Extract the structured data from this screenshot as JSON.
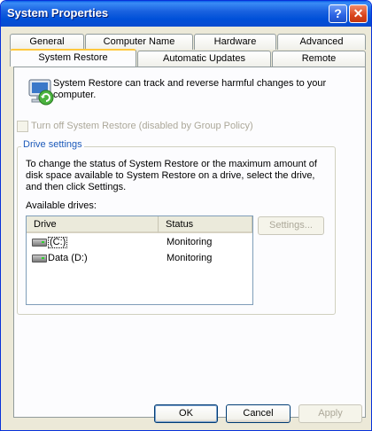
{
  "window": {
    "title": "System Properties"
  },
  "titlebar": {
    "help_glyph": "?",
    "close_glyph": "✕"
  },
  "tabs_row1": [
    "General",
    "Computer Name",
    "Hardware",
    "Advanced"
  ],
  "tabs_row2": [
    "System Restore",
    "Automatic Updates",
    "Remote"
  ],
  "active_tab": "System Restore",
  "intro_text": "System Restore can track and reverse harmful changes to your computer.",
  "turn_off": {
    "label": "Turn off System Restore (disabled by Group Policy)",
    "checked": false,
    "enabled": false
  },
  "drive_settings": {
    "legend": "Drive settings",
    "description": "To change the status of System Restore or the maximum amount of disk space available to System Restore on a drive, select the drive, and then click Settings.",
    "available_label": "Available drives:",
    "columns": [
      "Drive",
      "Status"
    ],
    "drives": [
      {
        "name": "(C:)",
        "status": "Monitoring",
        "icon": "hard-drive-icon"
      },
      {
        "name": "Data (D:)",
        "status": "Monitoring",
        "icon": "hard-drive-icon"
      }
    ],
    "settings_button": "Settings..."
  },
  "buttons": {
    "ok": "OK",
    "cancel": "Cancel",
    "apply": "Apply"
  },
  "colors": {
    "titlebar": "#0a4bd0",
    "dialog": "#ece9d8",
    "active_tab_accent": "#ffc83c"
  }
}
